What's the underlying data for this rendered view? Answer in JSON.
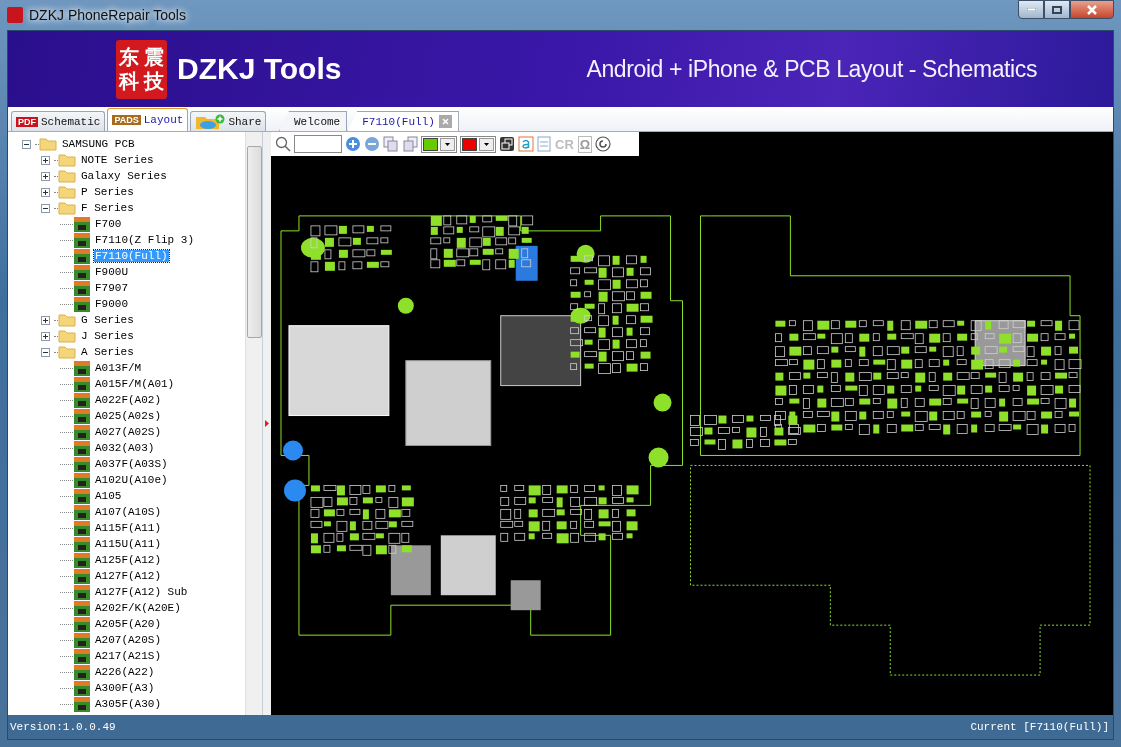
{
  "window": {
    "title": "DZKJ PhoneRepair Tools"
  },
  "banner": {
    "logo_chars": [
      "东",
      "震",
      "科",
      "技"
    ],
    "brand": "DZKJ Tools",
    "tagline": "Android + iPhone & PCB Layout - Schematics"
  },
  "side_tabs": [
    {
      "label": "Schematic",
      "badge": "PDF",
      "selected": false
    },
    {
      "label": "Layout",
      "badge": "PADS",
      "selected": true
    },
    {
      "label": "Share",
      "selected": false
    }
  ],
  "doc_tabs": [
    {
      "label": "Welcome",
      "selected": false,
      "closable": false
    },
    {
      "label": "F7110(Full)",
      "selected": true,
      "closable": true
    }
  ],
  "tree": [
    {
      "label": "SAMSUNG PCB",
      "kind": "folder",
      "expanded": true,
      "children": [
        {
          "label": "NOTE Series",
          "kind": "folder",
          "expanded": false
        },
        {
          "label": "Galaxy Series",
          "kind": "folder",
          "expanded": false
        },
        {
          "label": "P Series",
          "kind": "folder",
          "expanded": false
        },
        {
          "label": "F Series",
          "kind": "folder",
          "expanded": true,
          "children": [
            {
              "label": "F700",
              "kind": "board",
              "selected": false
            },
            {
              "label": "F7110(Z Flip 3)",
              "kind": "board",
              "selected": false
            },
            {
              "label": "F7110(Full)",
              "kind": "board",
              "selected": true
            },
            {
              "label": "F900U",
              "kind": "board",
              "selected": false
            },
            {
              "label": "F7907",
              "kind": "board",
              "selected": false
            },
            {
              "label": "F9000",
              "kind": "board",
              "selected": false
            }
          ]
        },
        {
          "label": "G Series",
          "kind": "folder",
          "expanded": false
        },
        {
          "label": "J Series",
          "kind": "folder",
          "expanded": false
        },
        {
          "label": "A Series",
          "kind": "folder",
          "expanded": true,
          "children": [
            {
              "label": "A013F/M",
              "kind": "board",
              "selected": false
            },
            {
              "label": "A015F/M(A01)",
              "kind": "board",
              "selected": false
            },
            {
              "label": "A022F(A02)",
              "kind": "board",
              "selected": false
            },
            {
              "label": "A025(A02s)",
              "kind": "board",
              "selected": false
            },
            {
              "label": "A027(A02S)",
              "kind": "board",
              "selected": false
            },
            {
              "label": "A032(A03)",
              "kind": "board",
              "selected": false
            },
            {
              "label": "A037F(A03S)",
              "kind": "board",
              "selected": false
            },
            {
              "label": "A102U(A10e)",
              "kind": "board",
              "selected": false
            },
            {
              "label": "A105",
              "kind": "board",
              "selected": false
            },
            {
              "label": "A107(A10S)",
              "kind": "board",
              "selected": false
            },
            {
              "label": "A115F(A11)",
              "kind": "board",
              "selected": false
            },
            {
              "label": "A115U(A11)",
              "kind": "board",
              "selected": false
            },
            {
              "label": "A125F(A12)",
              "kind": "board",
              "selected": false
            },
            {
              "label": "A127F(A12)",
              "kind": "board",
              "selected": false
            },
            {
              "label": "A127F(A12) Sub",
              "kind": "board",
              "selected": false
            },
            {
              "label": "A202F/K(A20E)",
              "kind": "board",
              "selected": false
            },
            {
              "label": "A205F(A20)",
              "kind": "board",
              "selected": false
            },
            {
              "label": "A207(A20S)",
              "kind": "board",
              "selected": false
            },
            {
              "label": "A217(A21S)",
              "kind": "board",
              "selected": false
            },
            {
              "label": "A226(A22)",
              "kind": "board",
              "selected": false
            },
            {
              "label": "A300F(A3)",
              "kind": "board",
              "selected": false
            },
            {
              "label": "A305F(A30)",
              "kind": "board",
              "selected": false
            }
          ]
        }
      ]
    }
  ],
  "toolbar": {
    "color_pickers": [
      {
        "color": "#66cc00"
      },
      {
        "color": "#ee0000"
      }
    ],
    "cr_label": "CR",
    "omega_label": "Ω"
  },
  "status_bar": {
    "version": "Version:1.0.0.49",
    "current": "Current [F7110(Full)]"
  }
}
